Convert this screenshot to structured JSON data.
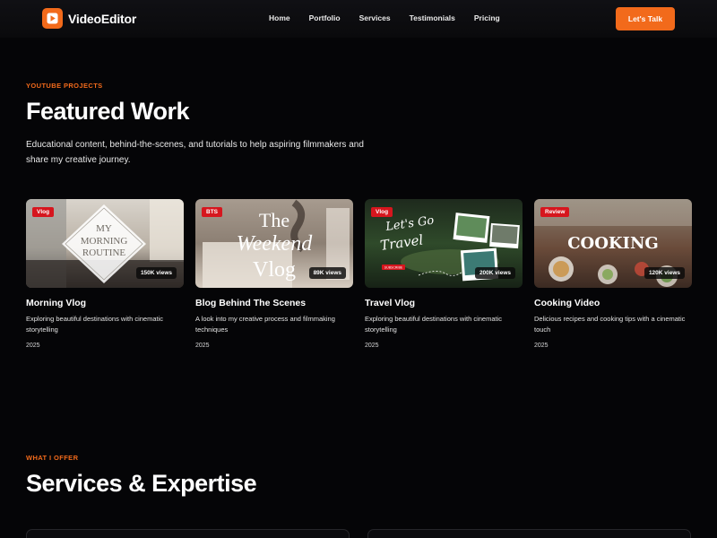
{
  "nav": {
    "logo_text": "VideoEditor",
    "links": [
      "Home",
      "Portfolio",
      "Services",
      "Testimonials",
      "Pricing"
    ],
    "cta_label": "Let's Talk"
  },
  "featured": {
    "eyebrow": "YOUTUBE PROJECTS",
    "title": "Featured Work",
    "description": "Educational content, behind-the-scenes, and tutorials to help aspiring filmmakers and share my creative journey."
  },
  "cards": [
    {
      "badge": "Vlog",
      "views": "150K views",
      "title": "Morning Vlog",
      "description": "Exploring beautiful destinations with cinematic storytelling",
      "year": "2025",
      "thumb_lines": [
        "MY",
        "MORNING",
        "ROUTINE"
      ]
    },
    {
      "badge": "BTS",
      "views": "89K views",
      "title": "Blog Behind The Scenes",
      "description": "A look into my creative process and filmmaking techniques",
      "year": "2025",
      "thumb_lines": [
        "The",
        "Weekend",
        "Vlog"
      ]
    },
    {
      "badge": "Vlog",
      "views": "200K views",
      "title": "Travel Vlog",
      "description": "Exploring beautiful destinations with cinematic storytelling",
      "year": "2025",
      "thumb_lines": [
        "Let's Go",
        "Travel",
        "SUBSCRIBE"
      ]
    },
    {
      "badge": "Review",
      "views": "120K views",
      "title": "Cooking Video",
      "description": "Delicious recipes and cooking tips with a cinematic touch",
      "year": "2025",
      "thumb_lines": [
        "COOKING"
      ]
    }
  ],
  "services": {
    "eyebrow": "WHAT I OFFER",
    "title": "Services & Expertise"
  },
  "colors": {
    "accent": "#f26a1b",
    "badge": "#d6161e",
    "background": "#050507"
  }
}
